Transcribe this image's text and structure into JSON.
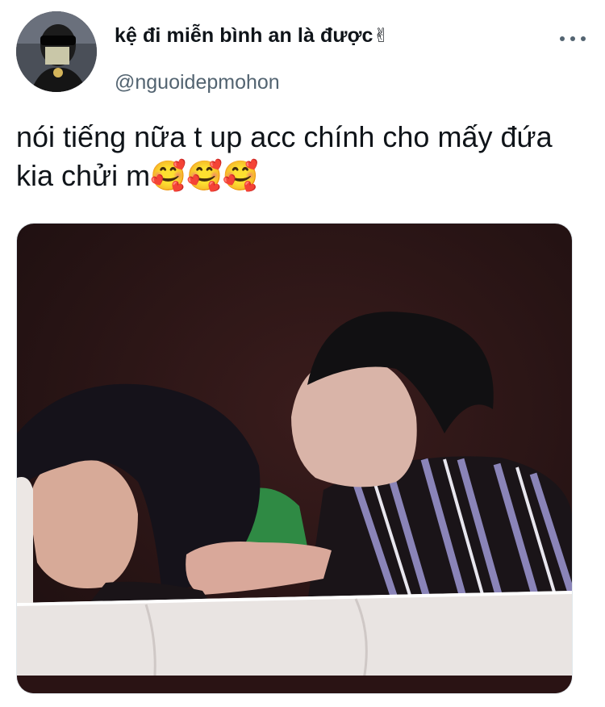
{
  "tweet": {
    "display_name": "kệ đi miễn bình an là được",
    "display_emoji": "✌",
    "handle": "@nguoidepmohon",
    "text": "nói tiếng nữa t up acc chính cho mấy đứa kia chửi m🥰🥰🥰",
    "more_icon": "more-horizontal-icon"
  },
  "media": {
    "description_icon": "photo",
    "colors": {
      "background": "#2a1416",
      "seat": "#e9e4e2"
    }
  }
}
